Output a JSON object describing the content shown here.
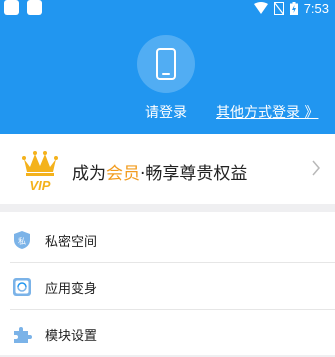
{
  "status_bar": {
    "time": "7:53"
  },
  "profile": {
    "avatar_icon": "phone-icon",
    "login_label": "请登录",
    "other_login_label": "其他方式登录 》"
  },
  "vip_banner": {
    "badge_text": "VIP",
    "text_prefix": "成为",
    "text_highlight": "会员",
    "text_suffix": "·畅享尊贵权益",
    "highlight_color": "#f29c1f"
  },
  "menu": {
    "items": [
      {
        "label": "私密空间",
        "icon": "private-space-icon",
        "icon_text": "私"
      },
      {
        "label": "应用变身",
        "icon": "app-disguise-icon"
      },
      {
        "label": "模块设置",
        "icon": "puzzle-icon"
      }
    ]
  },
  "colors": {
    "header": "#2196f0",
    "accent": "#f29c1f"
  }
}
